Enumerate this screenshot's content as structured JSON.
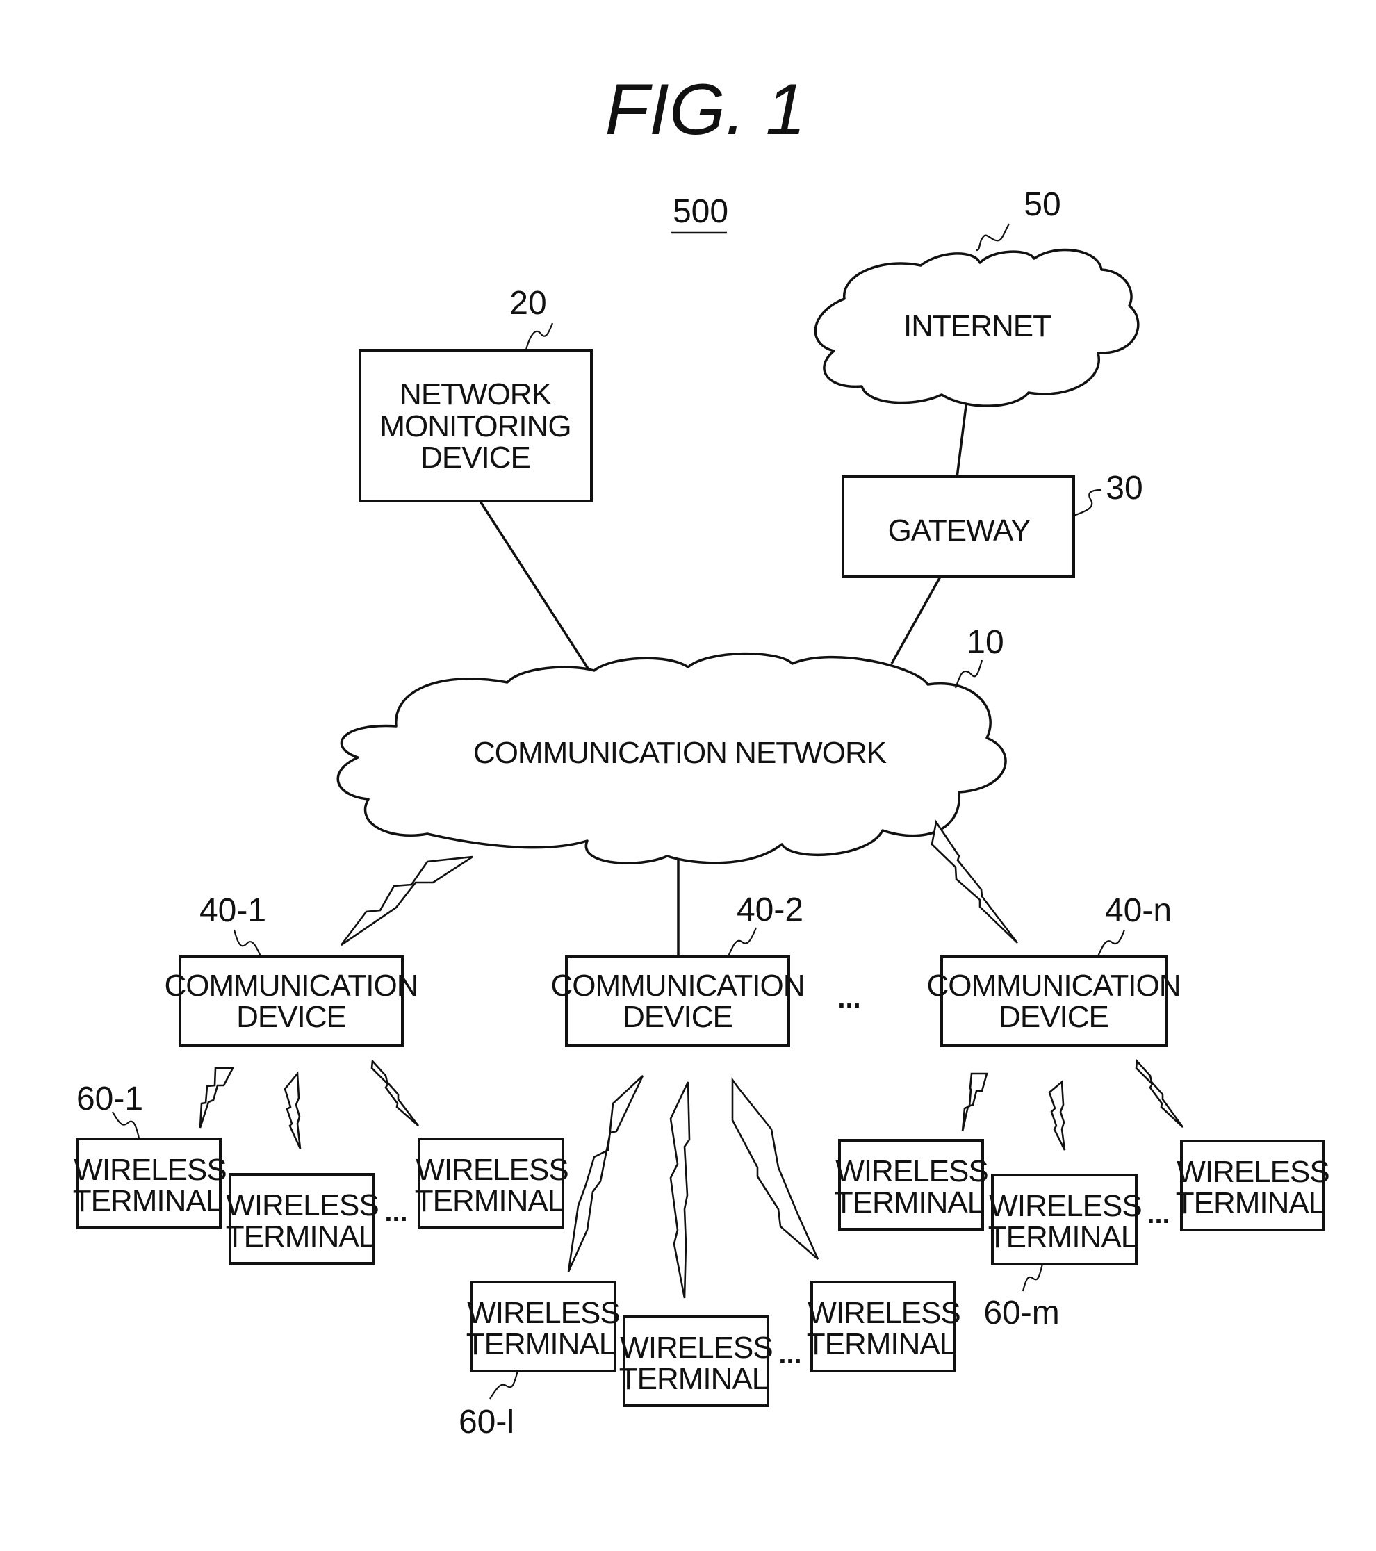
{
  "figure": {
    "title": "FIG.  1",
    "system_ref": "500"
  },
  "nodes": {
    "communication_network": {
      "ref": "10",
      "label": "COMMUNICATION NETWORK"
    },
    "network_monitoring_device": {
      "ref": "20",
      "lines": [
        "NETWORK",
        "MONITORING",
        "DEVICE"
      ]
    },
    "gateway": {
      "ref": "30",
      "label": "GATEWAY"
    },
    "internet": {
      "ref": "50",
      "label": "INTERNET"
    },
    "communication_devices": [
      {
        "ref": "40-1",
        "lines": [
          "COMMUNICATION",
          "DEVICE"
        ]
      },
      {
        "ref": "40-2",
        "lines": [
          "COMMUNICATION",
          "DEVICE"
        ]
      },
      {
        "ref": "40-n",
        "lines": [
          "COMMUNICATION",
          "DEVICE"
        ]
      }
    ],
    "wireless_terminal_groups": [
      {
        "parent": "40-1",
        "terminals": [
          {
            "ref": "60-1",
            "lines": [
              "WIRELESS",
              "TERMINAL"
            ]
          },
          {
            "ref": "",
            "lines": [
              "WIRELESS",
              "TERMINAL"
            ]
          },
          {
            "ref": "",
            "lines": [
              "WIRELESS",
              "TERMINAL"
            ]
          }
        ]
      },
      {
        "parent": "40-2",
        "terminals": [
          {
            "ref": "60-l",
            "lines": [
              "WIRELESS",
              "TERMINAL"
            ]
          },
          {
            "ref": "",
            "lines": [
              "WIRELESS",
              "TERMINAL"
            ]
          },
          {
            "ref": "",
            "lines": [
              "WIRELESS",
              "TERMINAL"
            ]
          }
        ]
      },
      {
        "parent": "40-n",
        "terminals": [
          {
            "ref": "",
            "lines": [
              "WIRELESS",
              "TERMINAL"
            ]
          },
          {
            "ref": "60-m",
            "lines": [
              "WIRELESS",
              "TERMINAL"
            ]
          },
          {
            "ref": "",
            "lines": [
              "WIRELESS",
              "TERMINAL"
            ]
          }
        ]
      }
    ]
  },
  "ellipsis": "..."
}
